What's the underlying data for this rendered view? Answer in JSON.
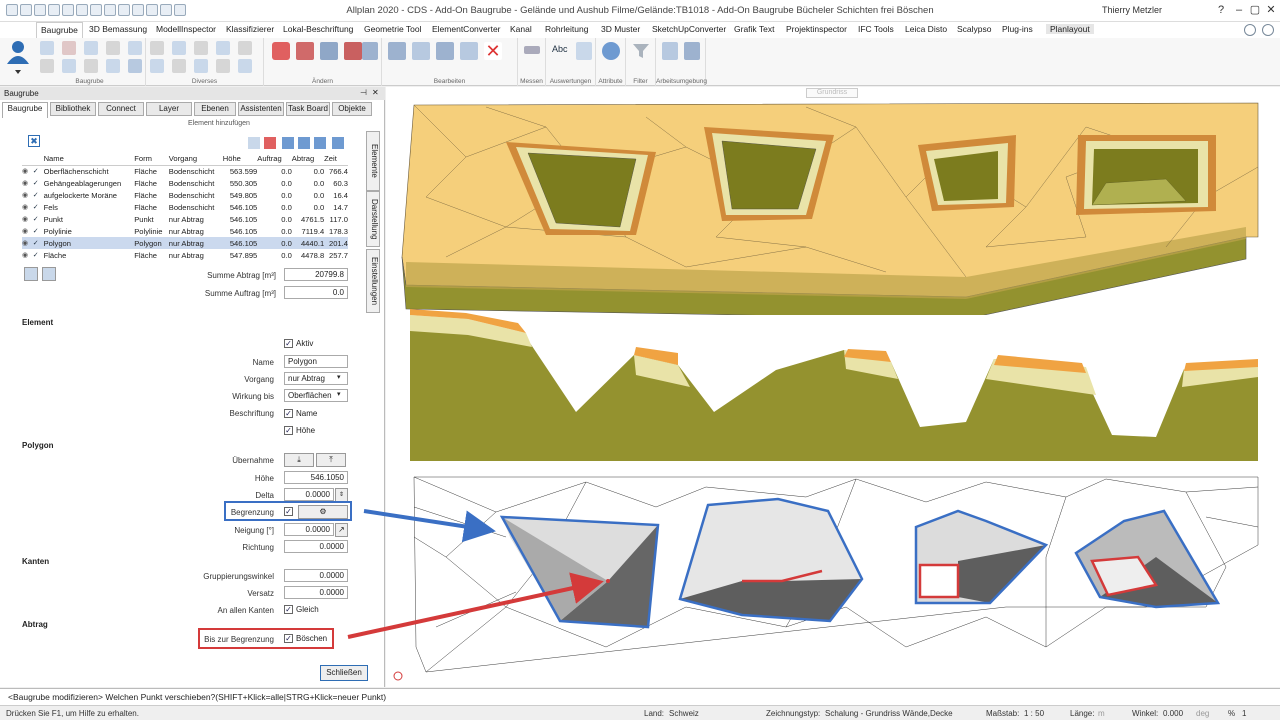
{
  "window": {
    "title": "Allplan 2020 - CDS - Add-On Baugrube - Gelände und Aushub Filme/Gelände:TB1018 - Add-On Baugrube Bücheler Schichten frei Böschen",
    "user": "Thierry Metzler"
  },
  "ribbon": {
    "tabs": [
      "Baugrube",
      "3D Bemassung",
      "ModellInspector",
      "Klassifizierer",
      "Lokal-Beschriftung",
      "Geometrie Tool",
      "ElementConverter",
      "Kanal",
      "Rohrleitung",
      "3D Muster",
      "SketchUpConverter",
      "Grafik Text",
      "Projektinspector",
      "IFC Tools",
      "Leica Disto",
      "Scalypso",
      "Plug-ins",
      "Planlayout"
    ],
    "groups": [
      "Baugrube",
      "Diverses",
      "Ändern",
      "Bearbeiten",
      "Messen",
      "Auswertungen",
      "Attribute",
      "Filter",
      "Arbeitsumgebung"
    ],
    "accent": "#2e6db4"
  },
  "palette": {
    "header": "Baugrube",
    "tabs": [
      "Baugrube",
      "Bibliothek",
      "Connect",
      "Layer",
      "Ebenen",
      "Assistenten",
      "Task Board",
      "Objekte"
    ],
    "side_tabs": [
      "Elemente",
      "Darstellung",
      "Einstellungen"
    ],
    "add_element_label": "Element hinzufügen",
    "columns": [
      "Name",
      "Form",
      "Vorgang",
      "Höhe",
      "Auftrag",
      "Abtrag",
      "Zeit"
    ],
    "rows": [
      {
        "name": "Oberflächenschicht",
        "form": "Fläche",
        "vorgang": "Bodenschicht",
        "hoehe": "563.599",
        "auftrag": "0.0",
        "abtrag": "0.0",
        "zeit": "766.4"
      },
      {
        "name": "Gehängeablagerungen",
        "form": "Fläche",
        "vorgang": "Bodenschicht",
        "hoehe": "550.305",
        "auftrag": "0.0",
        "abtrag": "0.0",
        "zeit": "60.3"
      },
      {
        "name": "aufgelockerte Moräne",
        "form": "Fläche",
        "vorgang": "Bodenschicht",
        "hoehe": "549.805",
        "auftrag": "0.0",
        "abtrag": "0.0",
        "zeit": "16.4"
      },
      {
        "name": "Fels",
        "form": "Fläche",
        "vorgang": "Bodenschicht",
        "hoehe": "546.105",
        "auftrag": "0.0",
        "abtrag": "0.0",
        "zeit": "14.7"
      },
      {
        "name": "Punkt",
        "form": "Punkt",
        "vorgang": "nur Abtrag",
        "hoehe": "546.105",
        "auftrag": "0.0",
        "abtrag": "4761.5",
        "zeit": "117.0"
      },
      {
        "name": "Polylinie",
        "form": "Polylinie",
        "vorgang": "nur Abtrag",
        "hoehe": "546.105",
        "auftrag": "0.0",
        "abtrag": "7119.4",
        "zeit": "178.3"
      },
      {
        "name": "Polygon",
        "form": "Polygon",
        "vorgang": "nur Abtrag",
        "hoehe": "546.105",
        "auftrag": "0.0",
        "abtrag": "4440.1",
        "zeit": "201.4"
      },
      {
        "name": "Fläche",
        "form": "Fläche",
        "vorgang": "nur Abtrag",
        "hoehe": "547.895",
        "auftrag": "0.0",
        "abtrag": "4478.8",
        "zeit": "257.7"
      }
    ],
    "summe_abtrag_label": "Summe Abtrag [m³]",
    "summe_abtrag": "20799.8",
    "summe_auftrag_label": "Summe Auftrag [m³]",
    "summe_auftrag": "0.0",
    "element": {
      "section": "Element",
      "aktiv": "Aktiv",
      "name_label": "Name",
      "name": "Polygon",
      "vorgang_label": "Vorgang",
      "vorgang": "nur Abtrag",
      "wirkung_label": "Wirkung bis",
      "wirkung": "Oberflächen",
      "beschriftung_label": "Beschriftung",
      "beschr_name": "Name",
      "beschr_hoehe": "Höhe"
    },
    "polygon": {
      "section": "Polygon",
      "uebernahme_label": "Übernahme",
      "hoehe_label": "Höhe",
      "hoehe": "546.1050",
      "delta_label": "Delta",
      "delta": "0.0000",
      "begrenzung_label": "Begrenzung",
      "neigung_label": "Neigung [°]",
      "neigung": "0.0000",
      "richtung_label": "Richtung",
      "richtung": "0.0000"
    },
    "kanten": {
      "section": "Kanten",
      "gruppierung_label": "Gruppierungswinkel",
      "gruppierung": "0.0000",
      "versatz_label": "Versatz",
      "versatz": "0.0000",
      "an_allen_label": "An allen Kanten",
      "gleich": "Gleich"
    },
    "abtrag": {
      "section": "Abtrag",
      "bis_label": "Bis zur Begrenzung",
      "boeschen": "Böschen"
    },
    "close_button": "Schließen"
  },
  "viewport": {
    "tab_label": "Grundriss"
  },
  "command_line": "<Baugrube modifizieren> Welchen Punkt verschieben?(SHIFT+Klick=alle|STRG+Klick=neuer Punkt)",
  "status": {
    "help": "Drücken Sie F1, um Hilfe zu erhalten.",
    "land_label": "Land:",
    "land": "Schweiz",
    "zeichnungstyp_label": "Zeichnungstyp:",
    "zeichnungstyp": "Schalung - Grundriss Wände,Decke",
    "massstab_label": "Maßstab:",
    "massstab": "1 : 50",
    "laenge_label": "Länge:",
    "laenge_unit": "m",
    "winkel_label": "Winkel:",
    "winkel": "0.000",
    "winkel_unit": "deg",
    "percent": "%",
    "percent_val": "1"
  }
}
